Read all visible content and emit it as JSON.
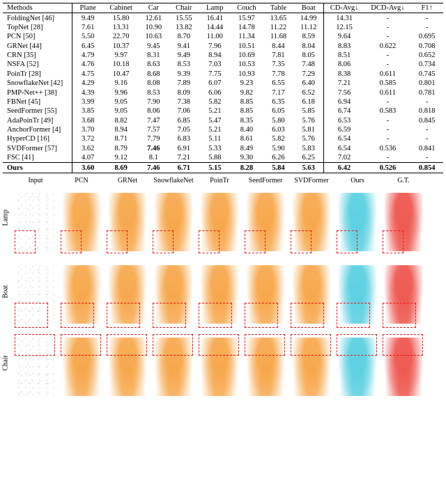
{
  "chart_data": {
    "type": "table",
    "columns": [
      "Methods",
      "Plane",
      "Cabinet",
      "Car",
      "Chair",
      "Lamp",
      "Couch",
      "Table",
      "Boat",
      "CD-Avg↓",
      "DCD-Avg↓",
      "F1↑"
    ],
    "rows": [
      {
        "method": "FoldingNet [46]",
        "vals": [
          "9.49",
          "15.80",
          "12.61",
          "15.55",
          "16.41",
          "15.97",
          "13.65",
          "14.99",
          "14.31",
          "-",
          "-"
        ]
      },
      {
        "method": "TopNet [28]",
        "vals": [
          "7.61",
          "13.31",
          "10.90",
          "13.82",
          "14.44",
          "14.78",
          "11.22",
          "11.12",
          "12.15",
          "-",
          "-"
        ]
      },
      {
        "method": "PCN [50]",
        "vals": [
          "5.50",
          "22.70",
          "10.63",
          "8.70",
          "11.00",
          "11.34",
          "11.68",
          "8.59",
          "9.64",
          "-",
          "0.695"
        ]
      },
      {
        "method": "GRNet [44]",
        "vals": [
          "6.45",
          "10.37",
          "9.45",
          "9.41",
          "7.96",
          "10.51",
          "8.44",
          "8.04",
          "8.83",
          "0.622",
          "0.708"
        ]
      },
      {
        "method": "CRN [35]",
        "vals": [
          "4.79",
          "9.97",
          "8.31",
          "9.49",
          "8.94",
          "10.69",
          "7.81",
          "8.05",
          "8.51",
          "-",
          "0.652"
        ]
      },
      {
        "method": "NSFA [52]",
        "vals": [
          "4.76",
          "10.18",
          "8.63",
          "8.53",
          "7.03",
          "10.53",
          "7.35",
          "7.48",
          "8.06",
          "-",
          "0.734"
        ]
      },
      {
        "method": "PoinTr [28]",
        "vals": [
          "4.75",
          "10.47",
          "8.68",
          "9.39",
          "7.75",
          "10.93",
          "7.78",
          "7.29",
          "8.38",
          "0.611",
          "0.745"
        ]
      },
      {
        "method": "SnowflakeNet [42]",
        "vals": [
          "4.29",
          "9.16",
          "8.08",
          "7.89",
          "6.07",
          "9.23",
          "6.55",
          "6.40",
          "7.21",
          "0.585",
          "0.801"
        ]
      },
      {
        "method": "PMP-Net++ [38]",
        "vals": [
          "4.39",
          "9.96",
          "8.53",
          "8.09",
          "6.06",
          "9.82",
          "7.17",
          "6.52",
          "7.56",
          "0.611",
          "0.781"
        ]
      },
      {
        "method": "FBNet [45]",
        "vals": [
          "3.99",
          "9.05",
          "7.90",
          "7.38",
          "5.82",
          "8.85",
          "6.35",
          "6.18",
          "6.94",
          "-",
          "-"
        ]
      },
      {
        "method": "SeedFormer [55]",
        "vals": [
          "3.85",
          "9.05",
          "8.06",
          "7.06",
          "5.21",
          "8.85",
          "6.05",
          "5.85",
          "6.74",
          "0.583",
          "0.818"
        ]
      },
      {
        "method": "AdaPoinTr [49]",
        "vals": [
          "3.68",
          "8.82",
          "7.47",
          "6.85",
          "5.47",
          "8.35",
          "5.80",
          "5.76",
          "6.53",
          "-",
          "0.845"
        ]
      },
      {
        "method": "AnchorFormer [4]",
        "vals": [
          "3.70",
          "8.94",
          "7.57",
          "7.05",
          "5.21",
          "8.40",
          "6.03",
          "5.81",
          "6.59",
          "-",
          "-"
        ]
      },
      {
        "method": "HyperCD [16]",
        "vals": [
          "3.72",
          "8.71",
          "7.79",
          "6.83",
          "5.11",
          "8.61",
          "5.82",
          "5.76",
          "6.54",
          "-",
          "-"
        ]
      },
      {
        "method": "SVDFormer [57]",
        "vals": [
          "3.62",
          "8.79",
          "7.46",
          "6.91",
          "5.33",
          "8.49",
          "5.90",
          "5.83",
          "6.54",
          "0.536",
          "0.841"
        ],
        "boldcols": [
          2
        ]
      },
      {
        "method": "FSC [41]",
        "vals": [
          "4.07",
          "9.12",
          "8.1",
          "7.21",
          "5.88",
          "9.30",
          "6.26",
          "6.25",
          "7.02",
          "-",
          "-"
        ]
      }
    ],
    "ours_row": {
      "method": "Ours",
      "vals": [
        "3.60",
        "8.69",
        "7.46",
        "6.71",
        "5.15",
        "8.28",
        "5.84",
        "5.63",
        "6.42",
        "0.526",
        "0.854"
      ]
    }
  },
  "figure": {
    "col_labels": [
      "Input",
      "PCN",
      "GRNet",
      "SnowflakeNet",
      "PoinTr",
      "SeedFormer",
      "SVDFormer",
      "Ours",
      "G.T."
    ],
    "row_labels": [
      "Lamp",
      "Boat",
      "Chair"
    ],
    "col_colors": [
      "sparse",
      "orange",
      "orange",
      "orange",
      "orange",
      "orange",
      "orange",
      "cyan",
      "red"
    ]
  }
}
